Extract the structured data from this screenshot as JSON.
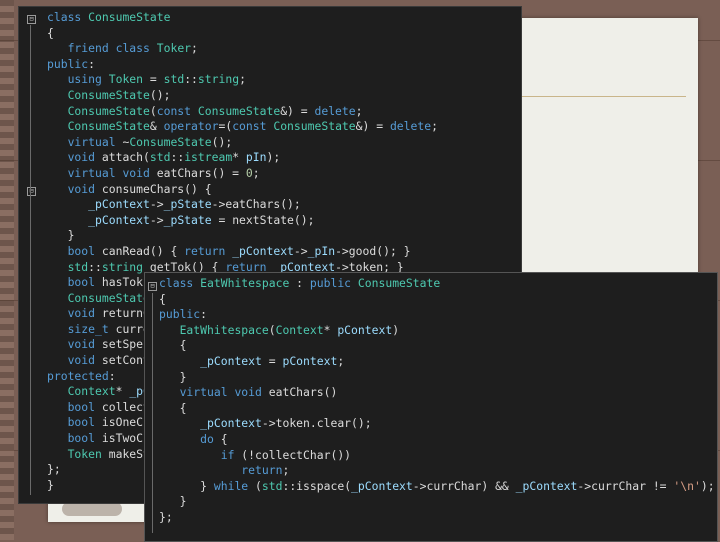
{
  "panel1_lines": [
    "class ConsumeState",
    "{",
    "   friend class Toker;",
    "public:",
    "   using Token = std::string;",
    "   ConsumeState();",
    "   ConsumeState(const ConsumeState&) = delete;",
    "   ConsumeState& operator=(const ConsumeState&) = delete;",
    "   virtual ~ConsumeState();",
    "   void attach(std::istream* pIn);",
    "   virtual void eatChars() = 0;",
    "   void consumeChars() {",
    "      _pContext->_pState->eatChars();",
    "      _pContext->_pState = nextState();",
    "   }",
    "   bool canRead() { return _pContext->_pIn->good(); }",
    "   std::string getTok() { return _pContext->token; }",
    "   bool hasTok(",
    "   ConsumeState*",
    "   void returnC",
    "   size_t curren",
    "   void setSpec",
    "   void setCont",
    "protected:",
    "   Context* _pC",
    "   bool collect",
    "   bool isOneCha",
    "   bool isTwoCha",
    "   Token makeStr",
    "};",
    "}"
  ],
  "panel2_lines": [
    "class EatWhitespace : public ConsumeState",
    "{",
    "public:",
    "   EatWhitespace(Context* pContext)",
    "   {",
    "      _pContext = pContext;",
    "   }",
    "   virtual void eatChars()",
    "   {",
    "      _pContext->token.clear();",
    "      do {",
    "         if (!collectChar())",
    "            return;",
    "      } while (std::isspace(_pContext->currChar) && _pContext->currChar != '\\n');",
    "   }",
    "};"
  ],
  "fold_markers": [
    "⊟",
    "⊟",
    "⊟"
  ]
}
